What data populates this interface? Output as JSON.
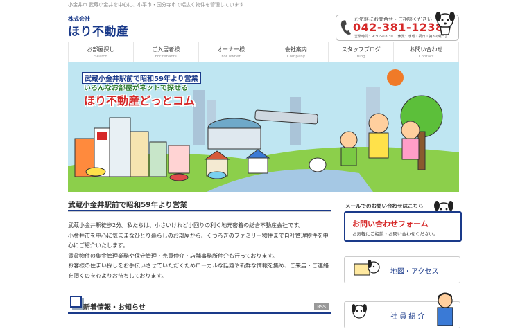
{
  "header": {
    "tagline": "小金井市 武蔵小金井を中心に、小平市・国分寺市で幅広く物件を管理しています",
    "logo_sub": "株式会社",
    "logo_main": "ほり不動産",
    "tel_small": "お気軽にお問合せ・ご相談ください",
    "tel_number": "042-381-1238",
    "tel_hours": "営業時間：9:30〜18:30　[休業：水曜・祝日・第3火曜日]"
  },
  "nav": [
    {
      "jp": "お部屋探し",
      "en": "Search"
    },
    {
      "jp": "ご入居者様",
      "en": "For tenants"
    },
    {
      "jp": "オーナー様",
      "en": "For owner"
    },
    {
      "jp": "会社案内",
      "en": "Company"
    },
    {
      "jp": "スタッフブログ",
      "en": "blog"
    },
    {
      "jp": "お問い合わせ",
      "en": "Contact"
    }
  ],
  "hero": {
    "line1": "武蔵小金井駅前で昭和59年より営業",
    "line2": "いろんなお部屋がネットで探せる",
    "line3": "ほり不動産どっとコム"
  },
  "main": {
    "title": "武蔵小金井駅前で昭和59年より営業",
    "paragraphs": [
      "武蔵小金井駅徒歩2分。私たちは、小さいけれど小回りの利く地元密着の総合不動産会社です。",
      "小金井市を中心に気ままなひとり暮らしのお部屋から、くつろぎのファミリー物件まで自社管理物件を中心にご紹介いたします。",
      "賃貸物件の集金管理業務や保守管理・売買仲介・店舗事務所仲介も行っております。",
      "お客様の住まい探しをお手伝いさせていただくためローカルな話題や新鮮な情報を集め、ご来店・ご連絡を頂くのを心よりお待ちしております。"
    ],
    "news_title": "新着情報・お知らせ",
    "rss": "RSS"
  },
  "side": {
    "mail_label": "メールでのお問い合わせはこちら",
    "contact_title": "お問い合わせフォーム",
    "contact_sub": "お気軽にご相談・お問い合わせください。",
    "map_label": "地図・アクセス",
    "staff_label": "社 員 紹 介"
  },
  "colors": {
    "brand": "#1a3a8a",
    "accent": "#d62828"
  }
}
